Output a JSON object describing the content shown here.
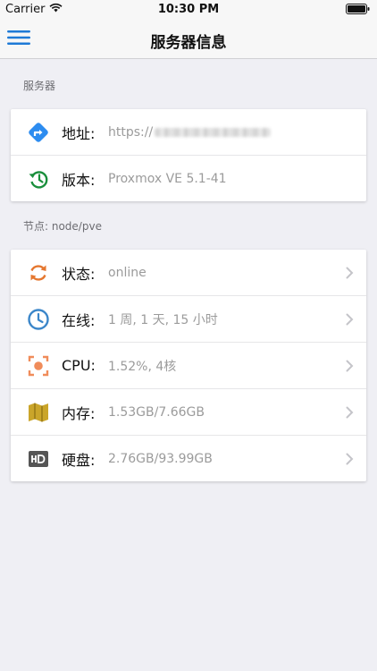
{
  "status_bar": {
    "carrier": "Carrier",
    "time": "10:30 PM"
  },
  "nav": {
    "title": "服务器信息"
  },
  "server_section": {
    "header": "服务器",
    "rows": [
      {
        "label": "地址:",
        "value": "https://",
        "icon": "directions-icon",
        "color": "#2d8cf0"
      },
      {
        "label": "版本:",
        "value": "Proxmox VE 5.1-41",
        "icon": "history-icon",
        "color": "#1a8f3c"
      }
    ]
  },
  "node_section": {
    "header": "节点: node/pve",
    "rows": [
      {
        "label": "状态:",
        "value": "online",
        "icon": "refresh-icon",
        "color": "#e5772f"
      },
      {
        "label": "在线:",
        "value": "1 周, 1 天, 15 小时",
        "icon": "clock-icon",
        "color": "#3b86c9"
      },
      {
        "label": "CPU:",
        "value": "1.52%, 4核",
        "icon": "cpu-icon",
        "color": "#f08c5a"
      },
      {
        "label": "内存:",
        "value": "1.53GB/7.66GB",
        "icon": "map-icon",
        "color": "#caa52a"
      },
      {
        "label": "硬盘:",
        "value": "2.76GB/93.99GB",
        "icon": "hd-icon",
        "color": "#555555"
      }
    ]
  }
}
